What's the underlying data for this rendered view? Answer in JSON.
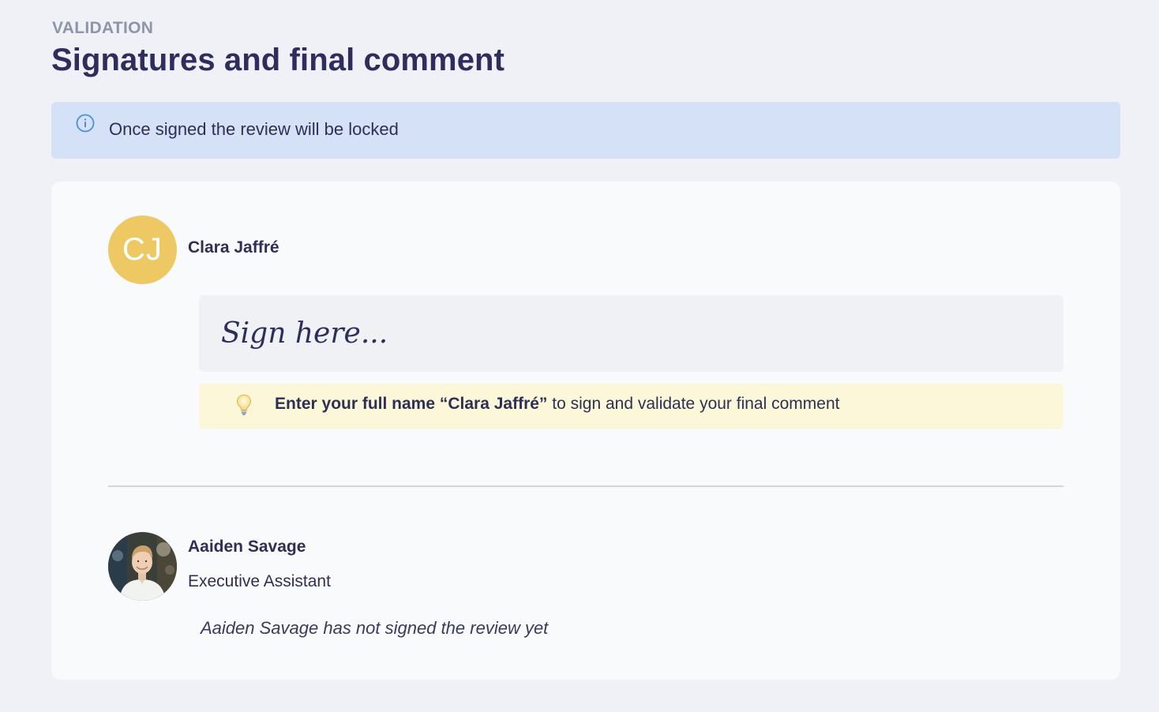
{
  "header": {
    "eyebrow": "VALIDATION",
    "title": "Signatures and final comment"
  },
  "info_banner": {
    "icon": "info-circle-icon",
    "text": "Once signed the review will be locked"
  },
  "current_signer": {
    "initials": "CJ",
    "name": "Clara Jaffré",
    "signature_placeholder": "Sign here...",
    "hint": {
      "icon": "lightbulb-icon",
      "bold_text": "Enter your full name “Clara Jaffré”",
      "text": " to sign and validate your final comment"
    }
  },
  "other_signer": {
    "name": "Aaiden Savage",
    "role": "Executive Assistant",
    "status": "Aaiden Savage has not signed the review yet"
  },
  "colors": {
    "background": "#f0f1f6",
    "info_banner": "#d4e1f7",
    "info_icon": "#4a90e2",
    "avatar_initials_bg": "#edc863",
    "hint_banner": "#fdf7d9",
    "text_primary": "#2f2f56"
  }
}
